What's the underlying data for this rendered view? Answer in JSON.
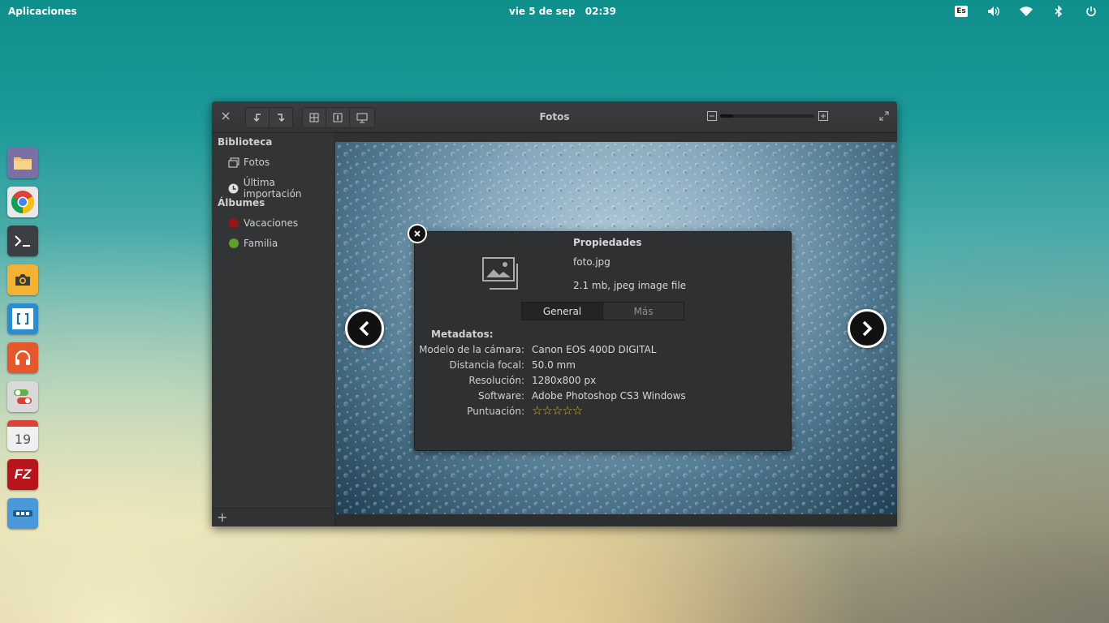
{
  "panel": {
    "apps_label": "Aplicaciones",
    "date": "vie  5 de sep",
    "time": "02:39",
    "keyboard_layout": "Es",
    "indicators": [
      "volume-icon",
      "wifi-icon",
      "bluetooth-icon",
      "power-icon"
    ]
  },
  "dock": [
    {
      "name": "files",
      "icon": "folder-icon",
      "color": "#7a6fa6"
    },
    {
      "name": "chrome",
      "icon": "chrome-icon",
      "color": "#e8e8e8"
    },
    {
      "name": "terminal",
      "icon": "terminal-icon",
      "color": "#3b3f44"
    },
    {
      "name": "camera",
      "icon": "camera-icon",
      "color": "#f2b233"
    },
    {
      "name": "brackets",
      "icon": "brackets-icon",
      "color": "#2a8dd4"
    },
    {
      "name": "music",
      "icon": "headphones-icon",
      "color": "#e4582b"
    },
    {
      "name": "settings",
      "icon": "toggles-icon",
      "color": "#d9d9d9"
    },
    {
      "name": "calendar",
      "icon": "calendar-icon",
      "color": "#f0f0f0",
      "label": "19"
    },
    {
      "name": "filezilla",
      "icon": "filezilla-icon",
      "color": "#b7151b",
      "label": "FZ"
    },
    {
      "name": "more",
      "icon": "more-icon",
      "color": "#4a98d8"
    }
  ],
  "window": {
    "title": "Fotos",
    "sidebar": {
      "library_header": "Biblioteca",
      "library_items": [
        {
          "label": "Fotos",
          "icon": "photos-icon"
        },
        {
          "label": "Última importación",
          "icon": "clock-icon"
        }
      ],
      "albums_header": "Álbumes",
      "album_items": [
        {
          "label": "Vacaciones",
          "icon": "album-dot-icon",
          "color": "#9b1414"
        },
        {
          "label": "Familia",
          "icon": "album-dot-icon",
          "color": "#5d9e2d"
        }
      ],
      "add_label": "+"
    }
  },
  "properties": {
    "title": "Propiedades",
    "filename": "foto.jpg",
    "fileinfo": "2.1 mb, jpeg image file",
    "tabs": [
      "General",
      "Más"
    ],
    "active_tab": "General",
    "metadata_header": "Metadatos:",
    "rows": [
      {
        "key": "Modelo de la cámara:",
        "value": "Canon EOS 400D DIGITAL"
      },
      {
        "key": "Distancia focal:",
        "value": "50.0 mm"
      },
      {
        "key": "Resolución:",
        "value": "1280x800 px"
      },
      {
        "key": "Software:",
        "value": "Adobe Photoshop CS3 Windows"
      },
      {
        "key": "Puntuación:",
        "value": "☆☆☆☆☆"
      }
    ],
    "rating": 0,
    "rating_max": 5
  }
}
